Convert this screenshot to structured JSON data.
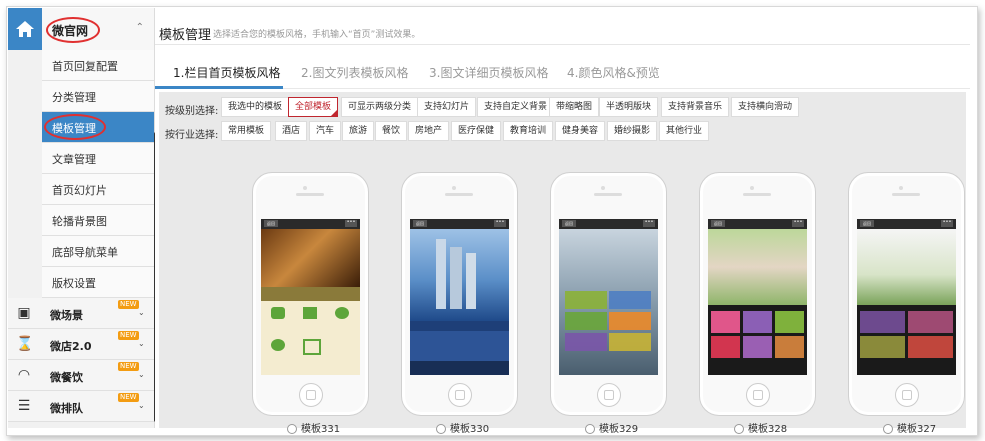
{
  "sidebar": {
    "header": "微官网",
    "sub_items": [
      {
        "label": "首页回复配置",
        "active": false
      },
      {
        "label": "分类管理",
        "active": false
      },
      {
        "label": "模板管理",
        "active": true
      },
      {
        "label": "文章管理",
        "active": false
      },
      {
        "label": "首页幻灯片",
        "active": false
      },
      {
        "label": "轮播背景图",
        "active": false
      },
      {
        "label": "底部导航菜单",
        "active": false
      },
      {
        "label": "版权设置",
        "active": false
      }
    ],
    "groups": [
      {
        "label": "微场景",
        "icon": "camera-icon",
        "badge": "NEW"
      },
      {
        "label": "微店2.0",
        "icon": "spinner-icon",
        "badge": "NEW"
      },
      {
        "label": "微餐饮",
        "icon": "restaurant-icon",
        "badge": "NEW"
      },
      {
        "label": "微排队",
        "icon": "queue-icon",
        "badge": "NEW"
      }
    ]
  },
  "header": {
    "title": "模板管理",
    "description": "选择适合您的模板风格，手机输入“首页”测试效果。"
  },
  "tabs": [
    {
      "label": "1.栏目首页模板风格",
      "active": true
    },
    {
      "label": "2.图文列表模板风格",
      "active": false
    },
    {
      "label": "3.图文详细页模板风格",
      "active": false
    },
    {
      "label": "4.颜色风格&预览",
      "active": false
    }
  ],
  "filters": {
    "level_label": "按级别选择:",
    "level_options": [
      "我选中的模板",
      "全部模板",
      "可显示两级分类",
      "支持幻灯片",
      "支持自定义背景",
      "带缩略图",
      "半透明版块",
      "支持背景音乐",
      "支持横向滑动"
    ],
    "level_selected": "全部模板",
    "industry_label": "按行业选择:",
    "industry_options": [
      "常用模板",
      "酒店",
      "汽车",
      "旅游",
      "餐饮",
      "房地产",
      "医疗保健",
      "教育培训",
      "健身美容",
      "婚纱摄影",
      "其他行业"
    ]
  },
  "templates": [
    {
      "label": "模板331",
      "theme": "hotel"
    },
    {
      "label": "模板330",
      "theme": "realestate"
    },
    {
      "label": "模板329",
      "theme": "fashion"
    },
    {
      "label": "模板328",
      "theme": "wedding"
    },
    {
      "label": "模板327",
      "theme": "wedding2"
    }
  ],
  "phone_screen": {
    "back": "返回",
    "more": "•••"
  },
  "colors": {
    "accent": "#3b86c6",
    "selected": "#c0262f"
  }
}
